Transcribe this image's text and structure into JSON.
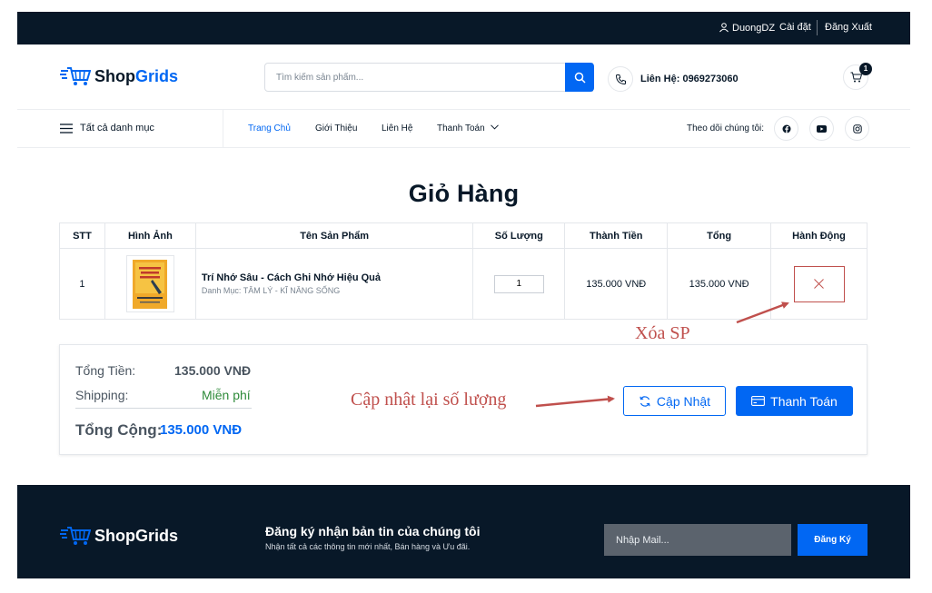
{
  "topbar": {
    "username": "DuongDZ",
    "settings": "Cài đặt",
    "logout": "Đăng Xuất"
  },
  "brand": {
    "name_dark": "Shop",
    "name_accent": "Grids",
    "accent_color": "#0167f3",
    "dark_color": "#081828"
  },
  "header": {
    "search_placeholder": "Tìm kiếm sản phẩm...",
    "contact_label": "Liên Hệ: 0969273060",
    "cart_count": "1"
  },
  "nav": {
    "all_categories": "Tất cả danh mục",
    "links": [
      "Trang Chủ",
      "Giới Thiệu",
      "Liên Hệ",
      "Thanh Toán"
    ],
    "follow_label": "Theo dõi chúng tôi:",
    "socials": [
      "facebook-icon",
      "youtube-icon",
      "instagram-icon"
    ]
  },
  "page_title": "Giỏ Hàng",
  "table": {
    "headers": [
      "STT",
      "Hình Ảnh",
      "Tên Sản Phẩm",
      "Số Lượng",
      "Thành Tiền",
      "Tổng",
      "Hành Động"
    ],
    "rows": [
      {
        "stt": "1",
        "name": "Trí Nhớ Sâu - Cách Ghi Nhớ Hiệu Quả",
        "category": "Danh Mục: TÂM LÝ - KĨ NĂNG SỐNG",
        "quantity": "1",
        "unit_price": "135.000 VNĐ",
        "total": "135.000 VNĐ"
      }
    ]
  },
  "summary": {
    "subtotal_label": "Tổng Tiền:",
    "subtotal_value": "135.000 VNĐ",
    "shipping_label": "Shipping:",
    "shipping_value": "Miễn phí",
    "grand_label": "Tổng Cộng:",
    "grand_value": "135.000 VNĐ",
    "update_label": "Cập Nhật",
    "checkout_label": "Thanh Toán"
  },
  "annotations": {
    "delete_note": "Xóa SP",
    "update_note": "Cập nhật lại số lượng",
    "color": "#c0504d"
  },
  "footer": {
    "newsletter_title": "Đăng ký nhận bản tin của chúng tôi",
    "newsletter_desc": "Nhận tất cả các thông tin mới nhất, Bán hàng và Ưu đãi.",
    "mail_placeholder": "Nhập Mail...",
    "subscribe_label": "Đăng Ký"
  }
}
